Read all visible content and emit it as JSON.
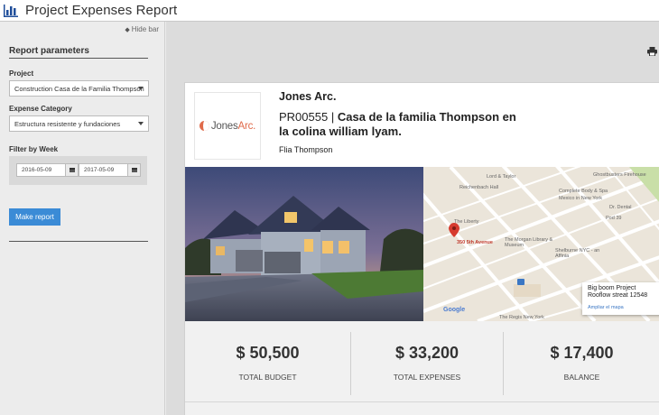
{
  "header": {
    "title": "Project Expenses Report"
  },
  "sidebar": {
    "hide_label": "Hide bar",
    "heading": "Report parameters",
    "project": {
      "label": "Project",
      "value": "Construction Casa de la Familia Thompson"
    },
    "category": {
      "label": "Expense Category",
      "value": "Estructura resistente y fundaciones"
    },
    "week": {
      "label": "Filter by Week",
      "from": "2016-05-09",
      "to": "2017-05-09"
    },
    "submit_label": "Make report"
  },
  "report": {
    "brand": {
      "text_a": "Jones",
      "text_b": "Arc."
    },
    "company": "Jones Arc.",
    "project_code": "PR00555",
    "separator": "|",
    "project_name": "Casa de la familia Thompson en la colina william lyam.",
    "client": "Flia Thompson",
    "map": {
      "pin_label": "350 5th Avenue",
      "card_title": "Big boom Project",
      "card_address": "Rooflow streat 12548",
      "card_link": "Ampliar el mapa",
      "google": "Google",
      "labels": [
        "Lord & Taylor",
        "Reichenbach Hall",
        "The Liberty",
        "The Morgan Library & Museum",
        "Shelburne NYC - an Affinia",
        "Complete Body & Spa",
        "Mexico in New York",
        "Ghostbusters Firehouse",
        "The Regis New York",
        "Pod 39",
        "Dr. Dental"
      ]
    },
    "stats": [
      {
        "value": "$ 50,500",
        "label": "TOTAL BUDGET"
      },
      {
        "value": "$ 33,200",
        "label": "TOTAL EXPENSES"
      },
      {
        "value": "$ 17,400",
        "label": "BALANCE"
      }
    ]
  },
  "colors": {
    "accent": "#3b8bd6",
    "brand": "#e06a4a",
    "pin": "#d63b2f"
  }
}
